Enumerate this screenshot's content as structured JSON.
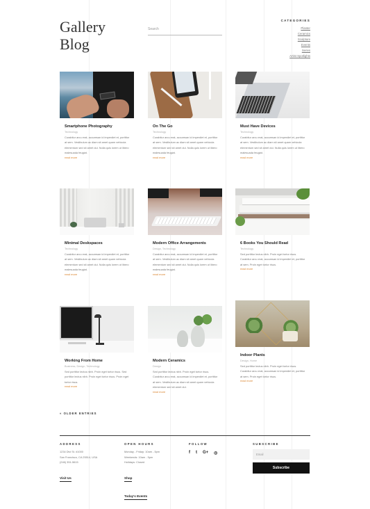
{
  "header": {
    "title": "Gallery Blog",
    "search_placeholder": "Search"
  },
  "categories": {
    "heading": "CATEGORIES",
    "items": [
      "Planter",
      "Ceramics",
      "Sculpture",
      "Events",
      "Series",
      "Artist Spotlights"
    ]
  },
  "posts": [
    {
      "title": "Smartphone Photography",
      "meta": "Technology",
      "excerpt": "Curabitur arcu erat, accumsan id imperdiet et, porttitor at sem. Vestibulum ac diam sit amet quam vehicula elementum sed sit amet dui. Nulla quis lorem ut libero malesuada feugiat.",
      "read_more": "read more"
    },
    {
      "title": "On The Go",
      "meta": "Technology",
      "excerpt": "Curabitur arcu erat, accumsan id imperdiet et, porttitor at sem. Vestibulum ac diam sit amet quam vehicula elementum sed sit amet dui. Nulla quis lorem ut libero malesuada feugiat.",
      "read_more": "read more"
    },
    {
      "title": "Must Have Devices",
      "meta": "Technology",
      "excerpt": "Curabitur arcu erat, accumsan id imperdiet et, porttitor at sem. Vestibulum ac diam sit amet quam vehicula elementum sed sit amet dui. Nulla quis lorem ut libero malesuada feugiat.",
      "read_more": "read more"
    },
    {
      "title": "Minimal Deskspaces",
      "meta": "Technology",
      "excerpt": "Curabitur arcu erat, accumsan id imperdiet et, porttitor at sem. Vestibulum ac diam sit amet quam vehicula elementum sed sit amet dui. Nulla quis lorem ut libero malesuada feugiat.",
      "read_more": "read more"
    },
    {
      "title": "Modern Office Arrangements",
      "meta": "Design, Technology",
      "excerpt": "Curabitur arcu erat, accumsan id imperdiet et, porttitor at sem. Vestibulum ac diam sit amet quam vehicula elementum sed sit amet dui. Nulla quis lorem ut libero malesuada feugiat.",
      "read_more": "read more"
    },
    {
      "title": "6 Books You Should Read",
      "meta": "Technology",
      "excerpt": "Sed porttitor lectus nibh. Proin eget tortor risus. Curabitur arcu erat, accumsan id imperdiet et, porttitor at sem. Proin eget tortor risus.",
      "read_more": "read more"
    },
    {
      "title": "Working From Home",
      "meta": "Business, Design, Technology",
      "excerpt": "Sed porttitor lectus nibh. Proin eget tortor risus. Sed porttitor lectus nibh. Proin eget tortor risus. Proin eget tortor risus.",
      "read_more": "read more"
    },
    {
      "title": "Modern Ceramics",
      "meta": "Design",
      "excerpt": "Sed porttitor lectus nibh. Proin eget tortor risus. Curabitur arcu erat, accumsan id imperdiet et, porttitor at sem. Vestibulum ac diam sit amet quam vehicula elementum sed sit amet dui.",
      "read_more": "read more"
    },
    {
      "title": "Indoor Plants",
      "meta": "Design, Home",
      "excerpt": "Sed porttitor lectus nibh. Proin eget tortor risus. Curabitur arcu erat, accumsan id imperdiet et, porttitor at sem. Proin eget tortor risus.",
      "read_more": "read more"
    }
  ],
  "pagination": {
    "older": "« OLDER ENTRIES"
  },
  "footer": {
    "address": {
      "heading": "ADDRESS",
      "lines": [
        "1234 Divi St. #1000",
        "San Francisco, CA 25514, USA",
        "(246) 351-5615"
      ],
      "link": "Visit Us"
    },
    "hours": {
      "heading": "OPEN HOURS",
      "lines": [
        "Monday - Friday: 10am - 5pm",
        "Weekends: 10am - 5pm",
        "Holidays: Closed"
      ],
      "link1": "Shop",
      "link2": "Today's Events"
    },
    "follow": {
      "heading": "FOLLOW",
      "icons": [
        "f",
        "t",
        "G+",
        "◎"
      ]
    },
    "subscribe": {
      "heading": "SUBSCRIBE",
      "email_placeholder": "Email",
      "button": "Subscribe"
    }
  },
  "colors": {
    "accent": "#d9822b",
    "text": "#222222",
    "muted": "#777777"
  }
}
